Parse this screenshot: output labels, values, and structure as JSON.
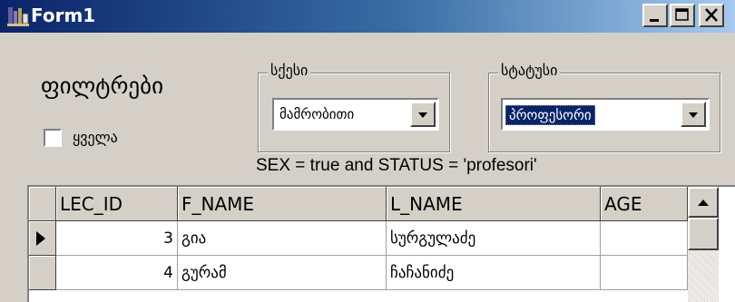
{
  "window": {
    "title": "Form1",
    "buttons": [
      "minimize",
      "maximize",
      "close"
    ]
  },
  "filters": {
    "heading": "ფილტრები",
    "all_checkbox": {
      "label": "ყველა",
      "checked": false
    }
  },
  "sex_group": {
    "title": "სქესი",
    "selected": "მამრობითი"
  },
  "status_group": {
    "title": "სტატუსი",
    "selected": "პროფესორი"
  },
  "filter_expression": "SEX = true and STATUS = 'profesori'",
  "grid": {
    "columns": [
      "LEC_ID",
      "F_NAME",
      "L_NAME",
      "AGE"
    ],
    "rows": [
      {
        "current": true,
        "cells": [
          "3",
          "გია",
          "სურგულაძე",
          ""
        ]
      },
      {
        "current": false,
        "cells": [
          "4",
          "გურამ",
          "ჩაჩანიძე",
          ""
        ]
      }
    ]
  },
  "icons": {
    "app": "app-icon",
    "dropdown": "chevron-down-icon",
    "row_pointer": "row-pointer-icon",
    "scroll_up": "scroll-up-icon"
  },
  "colors": {
    "titlebar_start": "#0a246a",
    "titlebar_end": "#a6caf0",
    "face": "#d4d0c8",
    "selection": "#0a246a"
  }
}
